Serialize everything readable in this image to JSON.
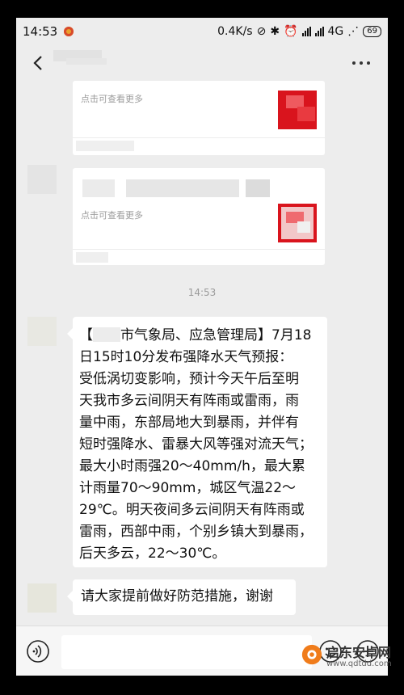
{
  "status_bar": {
    "time": "14:53",
    "speed": "0.4K/s",
    "network": "4G",
    "battery": "69"
  },
  "nav": {
    "back_icon": "chevron-left-icon",
    "more_icon": "more-dots-icon"
  },
  "cards": [
    {
      "hint": "点击可查看更多"
    },
    {
      "hint": "点击可查看更多"
    }
  ],
  "timestamp": "14:53",
  "messages": [
    {
      "lead": "【",
      "lines": [
        "市气象局、应急管理局】7月18",
        "日15时10分发布强降水天气预报：",
        "受低涡切变影响，预计今天午后至明",
        "天我市多云间阴天有阵雨或雷雨，雨",
        "量中雨，东部局地大到暴雨，并伴有",
        "短时强降水、雷暴大风等强对流天气；",
        "最大小时雨强20～40mm/h，最大累",
        "计雨量70～90mm，城区气温22～",
        "29℃。明天夜间多云间阴天有阵雨或",
        "雷雨，西部中雨，个别乡镇大到暴雨，",
        "后天多云，22～30℃。"
      ]
    },
    {
      "text": "请大家提前做好防范措施，谢谢"
    }
  ],
  "input_bar": {
    "voice_icon": "voice-icon",
    "emoji_icon": "emoji-icon",
    "plus_icon": "plus-icon"
  },
  "watermark": {
    "title": "启东安卓网",
    "url": "www.qdtdd.com"
  }
}
